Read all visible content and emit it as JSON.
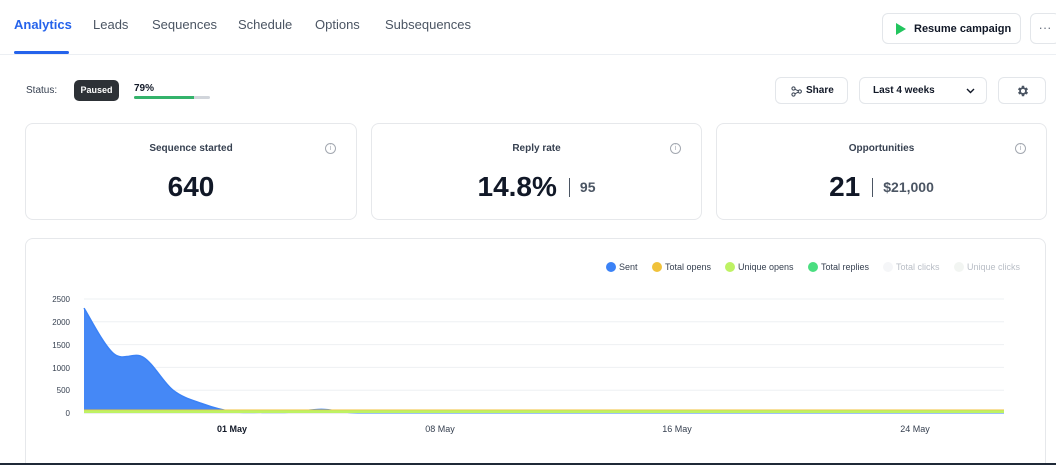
{
  "nav": {
    "tabs": [
      {
        "label": "Analytics",
        "active": true
      },
      {
        "label": "Leads"
      },
      {
        "label": "Sequences"
      },
      {
        "label": "Schedule"
      },
      {
        "label": "Options"
      },
      {
        "label": "Subsequences"
      }
    ],
    "resume_label": "Resume campaign",
    "more_label": "···"
  },
  "status": {
    "label": "Status:",
    "badge": "Paused",
    "progress_text": "79%",
    "progress": 0.79
  },
  "toolbar": {
    "share_label": "Share",
    "range_label": "Last 4 weeks"
  },
  "stats": [
    {
      "title": "Sequence started",
      "value": "640",
      "sub": ""
    },
    {
      "title": "Reply rate",
      "value": "14.8%",
      "sub": "95"
    },
    {
      "title": "Opportunities",
      "value": "21",
      "sub": "$21,000"
    }
  ],
  "colors": {
    "accent": "#2563eb",
    "sent": "#3b82f6",
    "total_opens": "#f0c23b",
    "unique_opens": "#bef264",
    "total_replies": "#4ade80",
    "total_clicks": "#f5f6f8",
    "unique_clicks": "#f2f5f2",
    "play": "#22c55e"
  },
  "icons": {
    "play": "play-icon",
    "share": "share-icon",
    "chevron": "chevron-down-icon",
    "gear": "gear-icon",
    "info": "info-icon"
  },
  "chart_data": {
    "type": "area",
    "legend": [
      "Sent",
      "Total opens",
      "Unique opens",
      "Total replies",
      "Total clicks",
      "Unique clicks"
    ],
    "legend_position": "top-right",
    "ylim": [
      0,
      2500
    ],
    "y_ticks": [
      0,
      500,
      1000,
      1500,
      2000,
      2500
    ],
    "x_tick_labels": [
      "01 May",
      "08 May",
      "16 May",
      "24 May"
    ],
    "grid": true,
    "series": [
      {
        "name": "Sent",
        "x": [
          "26 Apr",
          "27 Apr",
          "28 Apr",
          "29 Apr",
          "30 Apr",
          "01 May",
          "02 May",
          "03 May",
          "04 May",
          "05 May",
          "06 May",
          "07 May",
          "08 May",
          "09 May",
          "10 May",
          "11 May",
          "12 May",
          "13 May",
          "14 May",
          "15 May",
          "16 May",
          "17 May",
          "18 May",
          "19 May",
          "20 May",
          "21 May",
          "22 May",
          "23 May",
          "24 May",
          "25 May",
          "26 May",
          "27 May"
        ],
        "values": [
          2300,
          1300,
          1220,
          500,
          200,
          30,
          15,
          20,
          80,
          10,
          5,
          5,
          5,
          5,
          5,
          5,
          5,
          5,
          5,
          5,
          5,
          5,
          5,
          5,
          5,
          5,
          5,
          5,
          5,
          5,
          5,
          5
        ]
      },
      {
        "name": "Total opens",
        "values": [
          60,
          60,
          60,
          60,
          60,
          60,
          60,
          60,
          60,
          60,
          60,
          60,
          60,
          60,
          60,
          60,
          60,
          60,
          60,
          60,
          60,
          60,
          60,
          60,
          60,
          60,
          60,
          60,
          60,
          60,
          60,
          60
        ]
      },
      {
        "name": "Unique opens",
        "values": [
          45,
          45,
          45,
          45,
          45,
          45,
          45,
          45,
          45,
          45,
          45,
          45,
          45,
          45,
          45,
          45,
          45,
          45,
          45,
          45,
          45,
          45,
          45,
          45,
          45,
          45,
          45,
          45,
          45,
          45,
          45,
          45
        ]
      }
    ]
  }
}
